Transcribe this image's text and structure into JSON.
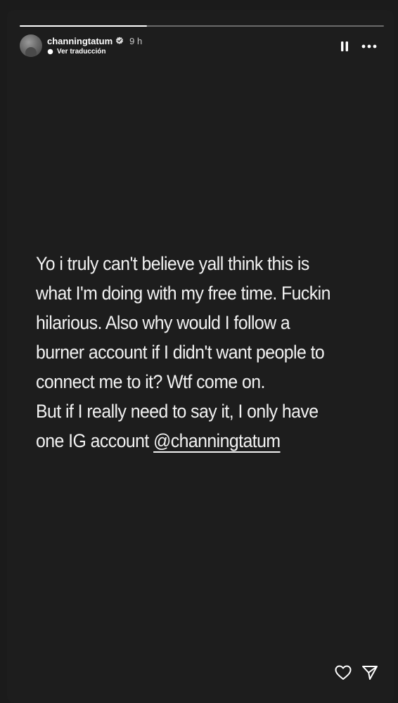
{
  "story": {
    "progress": 0.35,
    "author": {
      "username": "channingtatum",
      "verified": true,
      "posted_ago": "9 h",
      "avatar_icon": "avatar-photo"
    },
    "translate_label": "Ver traducción",
    "controls": {
      "pause_icon": "pause-icon",
      "more_icon": "more-icon"
    },
    "text_body": "Yo i truly can't believe yall think this is\nwhat I'm doing with my free time. Fuckin\nhilarious. Also why would I follow a\nburner account if I didn't want people to\nconnect me to it? Wtf come on.\nBut if I really need to say it, I only have\none IG account ",
    "mention": "@channingtatum",
    "footer": {
      "like_icon": "heart-icon",
      "share_icon": "send-icon"
    },
    "colors": {
      "background": "#1d1d1d",
      "text": "#f2f2f2"
    }
  }
}
